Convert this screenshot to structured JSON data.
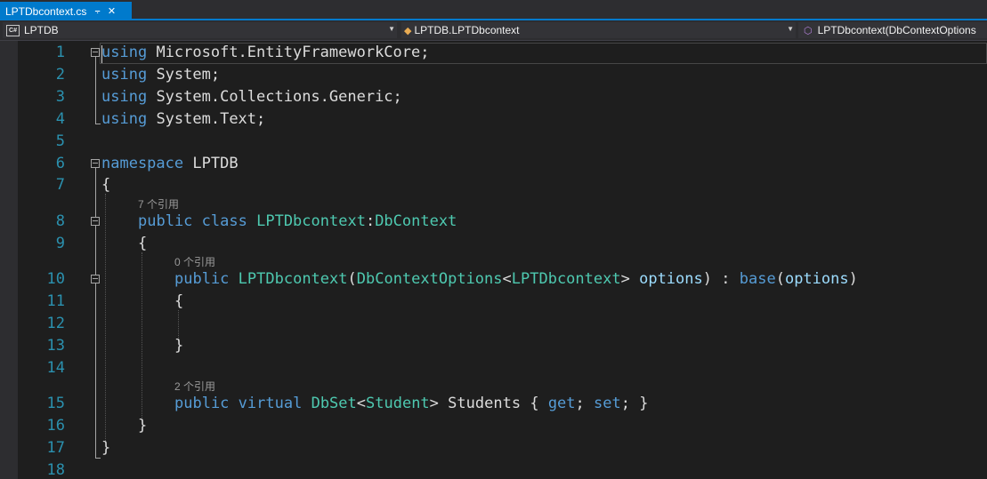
{
  "tab": {
    "filename": "LPTDbcontext.cs",
    "pin_icon": "⨪",
    "close_icon": "✕"
  },
  "nav": {
    "project": "LPTDB",
    "type": "LPTDB.LPTDbcontext",
    "member": "LPTDbcontext(DbContextOptions"
  },
  "line_numbers": [
    "1",
    "2",
    "3",
    "4",
    "5",
    "6",
    "7",
    "8",
    "9",
    "10",
    "11",
    "12",
    "13",
    "14",
    "15",
    "16",
    "17",
    "18"
  ],
  "refs": {
    "class_refs": "7 个引用",
    "ctor_refs": "0 个引用",
    "prop_refs": "2 个引用"
  },
  "code": {
    "l1": [
      "using",
      "Microsoft.EntityFrameworkCore;"
    ],
    "l2": [
      "using",
      "System;"
    ],
    "l3": [
      "using",
      "System.Collections.Generic;"
    ],
    "l4": [
      "using",
      "System.Text;"
    ],
    "l6": [
      "namespace",
      "LPTDB"
    ],
    "l7": [
      "{"
    ],
    "l8": [
      "public",
      "class",
      "LPTDbcontext",
      ":",
      "DbContext"
    ],
    "l9": [
      "{"
    ],
    "l10": [
      "public",
      "LPTDbcontext",
      "(",
      "DbContextOptions",
      "<",
      "LPTDbcontext",
      ">",
      "options",
      ")",
      ":",
      "base",
      "(",
      "options",
      ")"
    ],
    "l11": [
      "{"
    ],
    "l13": [
      "}"
    ],
    "l15": [
      "public",
      "virtual",
      "DbSet",
      "<",
      "Student",
      ">",
      "Students",
      "{",
      "get",
      ";",
      "set",
      ";",
      "}"
    ],
    "l16": [
      "}"
    ],
    "l17": [
      "}"
    ]
  },
  "colors": {
    "keyword": "#569cd6",
    "type": "#4ec9b0",
    "param": "#9cdcfe",
    "linenumber": "#2b91af",
    "accent": "#007acc"
  }
}
